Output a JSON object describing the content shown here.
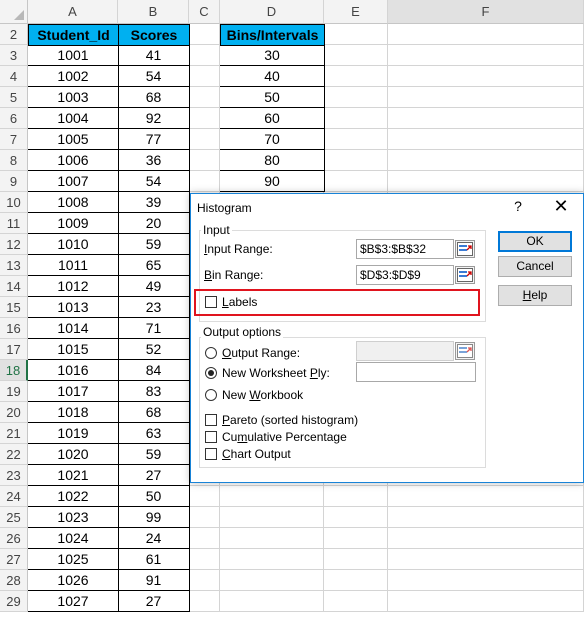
{
  "columns": [
    "A",
    "B",
    "C",
    "D",
    "E",
    "F"
  ],
  "headers": {
    "student_id": "Student_Id",
    "scores": "Scores",
    "bins": "Bins/Intervals"
  },
  "rows": [
    "2",
    "3",
    "4",
    "5",
    "6",
    "7",
    "8",
    "9",
    "10",
    "11",
    "12",
    "13",
    "14",
    "15",
    "16",
    "17",
    "18",
    "19",
    "20",
    "21",
    "22",
    "23",
    "24",
    "25",
    "26",
    "27",
    "28",
    "29"
  ],
  "students": [
    {
      "id": "1001",
      "score": "41"
    },
    {
      "id": "1002",
      "score": "54"
    },
    {
      "id": "1003",
      "score": "68"
    },
    {
      "id": "1004",
      "score": "92"
    },
    {
      "id": "1005",
      "score": "77"
    },
    {
      "id": "1006",
      "score": "36"
    },
    {
      "id": "1007",
      "score": "54"
    },
    {
      "id": "1008",
      "score": "39"
    },
    {
      "id": "1009",
      "score": "20"
    },
    {
      "id": "1010",
      "score": "59"
    },
    {
      "id": "1011",
      "score": "65"
    },
    {
      "id": "1012",
      "score": "49"
    },
    {
      "id": "1013",
      "score": "23"
    },
    {
      "id": "1014",
      "score": "71"
    },
    {
      "id": "1015",
      "score": "52"
    },
    {
      "id": "1016",
      "score": "84"
    },
    {
      "id": "1017",
      "score": "83"
    },
    {
      "id": "1018",
      "score": "68"
    },
    {
      "id": "1019",
      "score": "63"
    },
    {
      "id": "1020",
      "score": "59"
    },
    {
      "id": "1021",
      "score": "27"
    },
    {
      "id": "1022",
      "score": "50"
    },
    {
      "id": "1023",
      "score": "99"
    },
    {
      "id": "1024",
      "score": "24"
    },
    {
      "id": "1025",
      "score": "61"
    },
    {
      "id": "1026",
      "score": "91"
    },
    {
      "id": "1027",
      "score": "27"
    }
  ],
  "bins": [
    "30",
    "40",
    "50",
    "60",
    "70",
    "80",
    "90"
  ],
  "active_row": "18",
  "colors": {
    "header_fill": "#00b0f0",
    "highlight": "#e0141e",
    "dialog_border": "#1883d7"
  },
  "dialog": {
    "title": "Histogram",
    "help_glyph": "?",
    "close_glyph": "✕",
    "input_group": "Input",
    "input_range_label_u": "I",
    "input_range_label_rest": "nput Range:",
    "input_range_value": "$B$3:$B$32",
    "bin_range_label_u": "B",
    "bin_range_label_rest": "in Range:",
    "bin_range_value": "$D$3:$D$9",
    "labels_u": "L",
    "labels_rest": "abels",
    "output_group": "Output options",
    "output_range_u": "O",
    "output_range_rest": "utput Range:",
    "new_ws_pre": "New Worksheet ",
    "new_ws_u": "P",
    "new_ws_post": "ly:",
    "new_wb_pre": "New ",
    "new_wb_u": "W",
    "new_wb_post": "orkbook",
    "pareto_u": "P",
    "pareto_rest": "areto (sorted histogram)",
    "cumulative_pre": "Cu",
    "cumulative_u": "m",
    "cumulative_post": "ulative Percentage",
    "chart_u": "C",
    "chart_rest": "hart Output",
    "ok": "OK",
    "cancel": "Cancel",
    "help_u": "H",
    "help_rest": "elp",
    "selected_output": "new-worksheet-ply"
  }
}
